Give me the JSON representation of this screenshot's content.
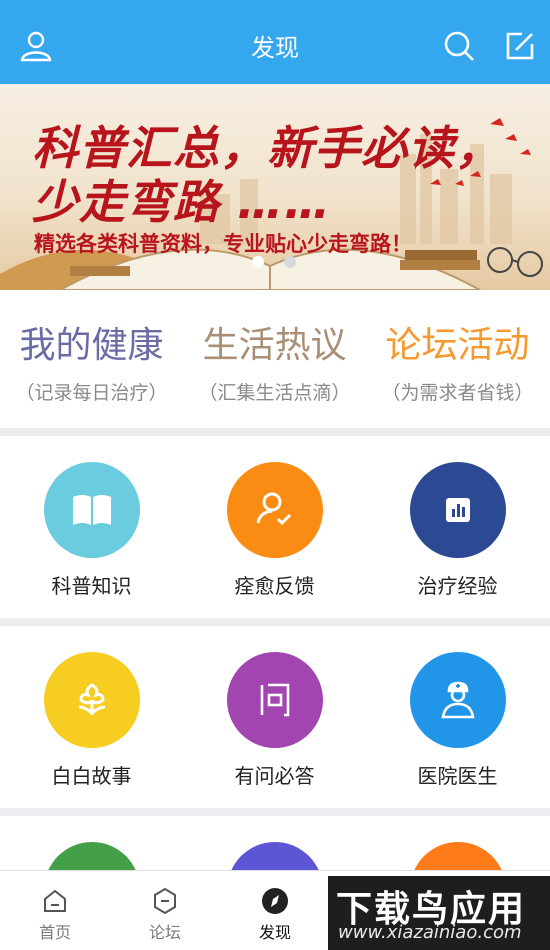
{
  "header": {
    "title": "发现"
  },
  "banner": {
    "headline1": "科普汇总，新手必读，",
    "headline2": "少走弯路 ……",
    "subtitle": "精选各类科普资料，专业贴心少走弯路！",
    "dots": 2,
    "active_dot": 1
  },
  "categories": [
    {
      "title": "我的健康",
      "subtitle": "（记录每日治疗）",
      "color": "#6b6ba5"
    },
    {
      "title": "生活热议",
      "subtitle": "（汇集生活点滴）",
      "color": "#a88f76"
    },
    {
      "title": "论坛活动",
      "subtitle": "（为需求者省钱）",
      "color": "#f59a2f"
    }
  ],
  "grid": [
    {
      "label": "科普知识",
      "icon": "book-icon",
      "color": "#6bcce0"
    },
    {
      "label": "痊愈反馈",
      "icon": "user-check-icon",
      "color": "#fa8c14"
    },
    {
      "label": "治疗经验",
      "icon": "chart-icon",
      "color": "#2c4a94"
    },
    {
      "label": "白白故事",
      "icon": "flower-icon",
      "color": "#f8cd22"
    },
    {
      "label": "有问必答",
      "icon": "question-icon",
      "color": "#a245b1"
    },
    {
      "label": "医院医生",
      "icon": "doctor-icon",
      "color": "#2196e8"
    },
    {
      "label": "",
      "icon": "green-icon",
      "color": "#43a047"
    },
    {
      "label": "",
      "icon": "purple-icon",
      "color": "#5d56d4"
    },
    {
      "label": "",
      "icon": "orange-icon",
      "color": "#ff7a18"
    }
  ],
  "tabs": [
    {
      "label": "首页",
      "icon": "home-icon",
      "active": false
    },
    {
      "label": "论坛",
      "icon": "forum-icon",
      "active": false
    },
    {
      "label": "发现",
      "icon": "discover-icon",
      "active": true
    }
  ],
  "watermark": {
    "title": "下载鸟应用",
    "url": "www.xiazainiao.com"
  }
}
